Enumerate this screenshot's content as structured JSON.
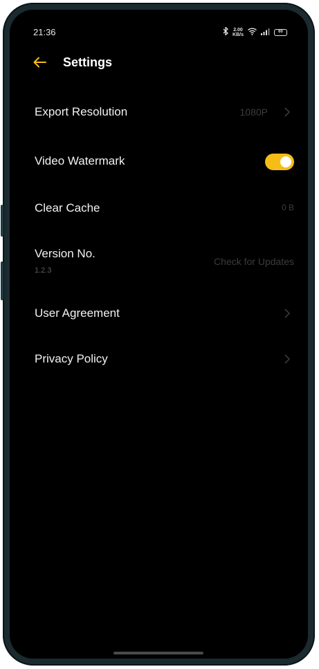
{
  "status_bar": {
    "time": "21:36",
    "network_speed_top": "2.00",
    "network_speed_bottom": "KB/s",
    "battery_level": "60"
  },
  "header": {
    "title": "Settings",
    "back_icon": "arrow-left-icon",
    "accent_color": "#f6bd16"
  },
  "settings": {
    "export_resolution": {
      "label": "Export Resolution",
      "value": "1080P"
    },
    "video_watermark": {
      "label": "Video Watermark",
      "enabled": true
    },
    "clear_cache": {
      "label": "Clear Cache",
      "value": "0 B"
    },
    "version": {
      "label": "Version No.",
      "number": "1.2.3",
      "action": "Check for Updates"
    },
    "user_agreement": {
      "label": "User Agreement"
    },
    "privacy_policy": {
      "label": "Privacy Policy"
    }
  }
}
